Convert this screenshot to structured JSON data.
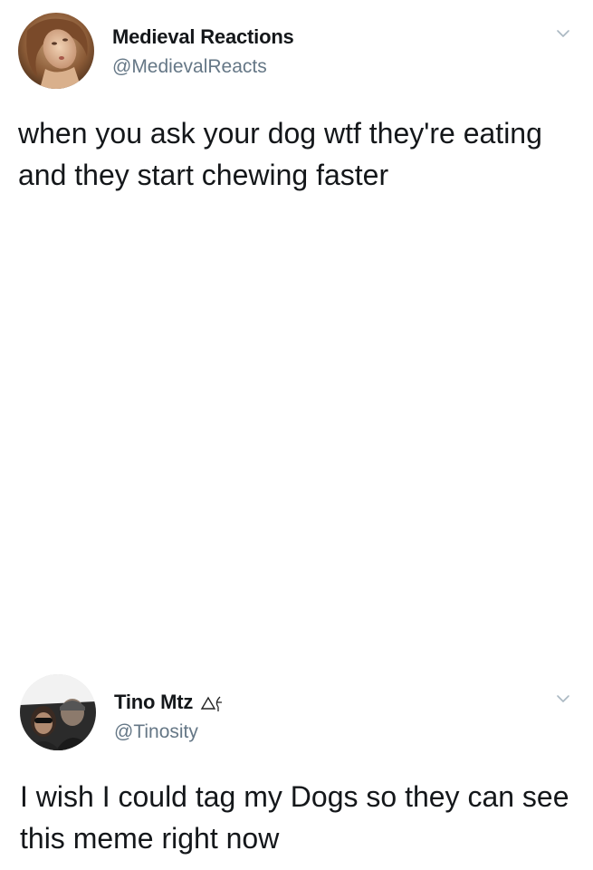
{
  "tweets": [
    {
      "display_name": "Medieval Reactions",
      "handle": "@MedievalReacts",
      "text": "when you ask your dog wtf they're eating and they start chewing faster",
      "avatar_icon": "medieval-painting-avatar"
    },
    {
      "display_name": "Tino Mtz",
      "name_emoji": "triangle-symbols",
      "handle": "@Tinosity",
      "text": "I wish I could tag my Dogs so they can see this meme right now",
      "avatar_icon": "car-selfie-avatar"
    }
  ],
  "colors": {
    "text": "#14171a",
    "secondary": "#657786",
    "background": "#ffffff"
  }
}
